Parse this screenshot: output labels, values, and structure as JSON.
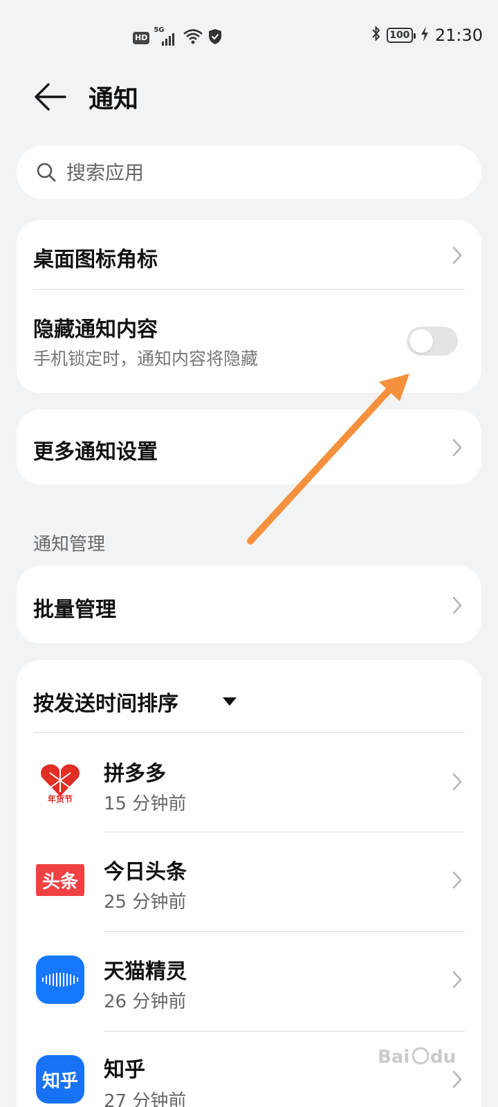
{
  "status_bar": {
    "hd_label": "HD",
    "network_label": "5G",
    "battery_level": "100",
    "time": "21:30"
  },
  "header": {
    "title": "通知"
  },
  "search": {
    "placeholder": "搜索应用"
  },
  "settings_card": {
    "badge_label": "桌面图标角标",
    "hide_content_label": "隐藏通知内容",
    "hide_content_desc": "手机锁定时，通知内容将隐藏",
    "hide_content_enabled": false
  },
  "more_card": {
    "label": "更多通知设置"
  },
  "notification_management": {
    "section_label": "通知管理",
    "batch_label": "批量管理"
  },
  "app_list": {
    "sort_label": "按发送时间排序",
    "apps": [
      {
        "name": "拼多多",
        "time": "15 分钟前",
        "icon_text": "年货节",
        "icon_color": "#e02e24"
      },
      {
        "name": "今日头条",
        "time": "25 分钟前",
        "icon_text": "头条",
        "icon_color": "#f04142"
      },
      {
        "name": "天猫精灵",
        "time": "26 分钟前",
        "icon_color": "#1677ff"
      },
      {
        "name": "知乎",
        "time": "27 分钟前",
        "icon_text": "知乎",
        "icon_color": "#1772f6"
      }
    ]
  },
  "colors": {
    "background": "#f1f3f5",
    "card": "#ffffff",
    "annotation_arrow": "#f5913c"
  }
}
